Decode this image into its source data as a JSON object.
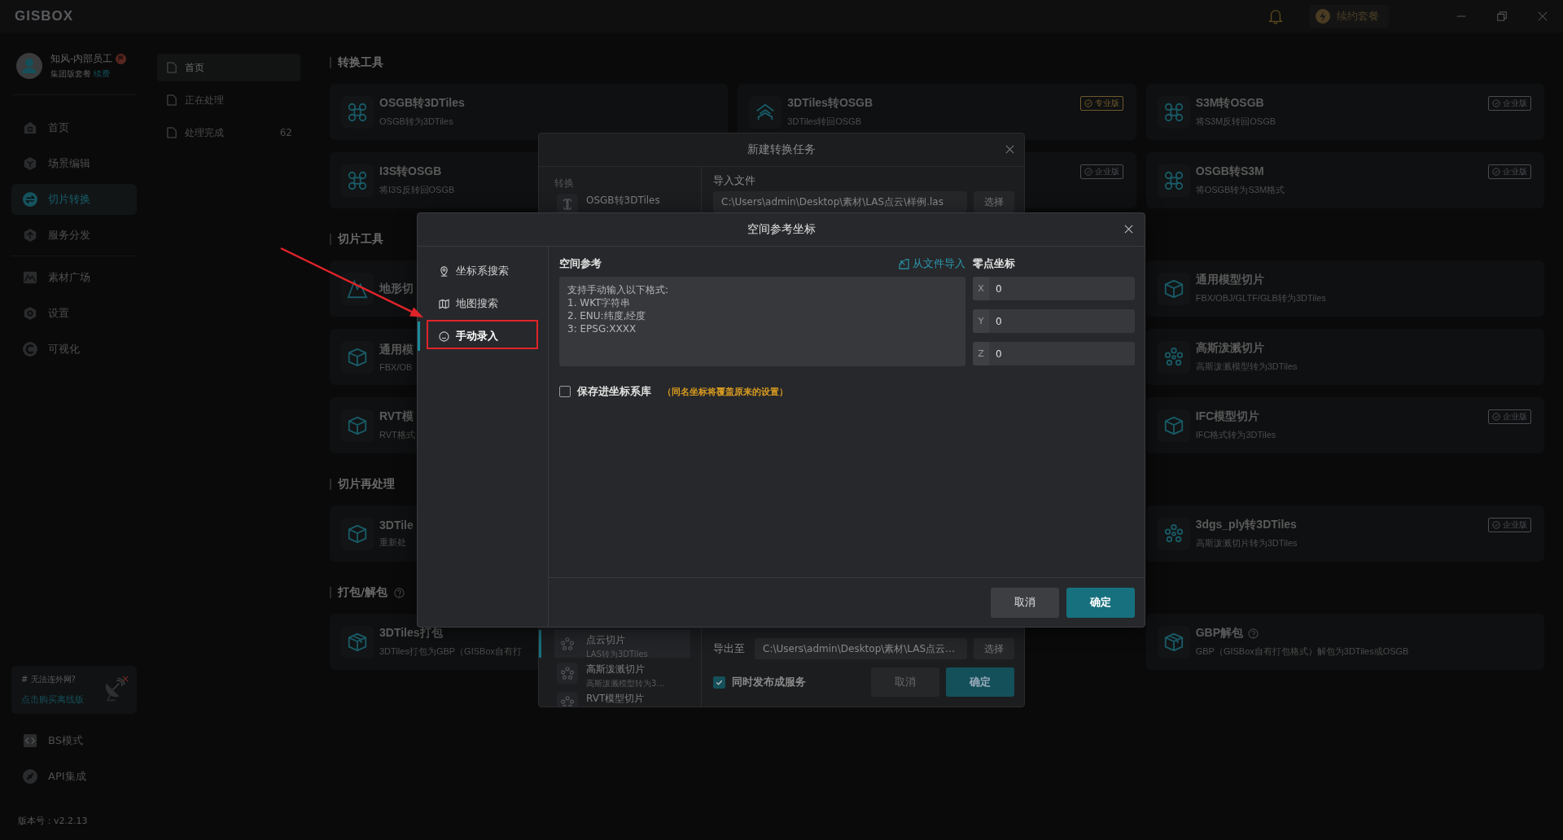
{
  "title_bar": {
    "logo": "GISBOX",
    "renew_button": "续约套餐"
  },
  "user": {
    "name": "知风-内部员工",
    "plan": "集团版套餐",
    "renew_link": "续费"
  },
  "nav_main": [
    {
      "label": "首页",
      "selected": false
    },
    {
      "label": "场景编辑",
      "selected": false
    },
    {
      "label": "切片转换",
      "selected": true
    },
    {
      "label": "服务分发",
      "selected": false
    }
  ],
  "nav_more": [
    {
      "label": "素材广场",
      "selected": false
    },
    {
      "label": "设置",
      "selected": false
    },
    {
      "label": "可视化",
      "selected": false
    }
  ],
  "promo": {
    "title": "# 无法连外网?",
    "link": "点击购买离线版"
  },
  "nav_bottom": [
    {
      "label": "BS模式"
    },
    {
      "label": "API集成"
    }
  ],
  "version": "版本号：v2.2.13",
  "subnav": [
    {
      "label": "首页",
      "selected": true
    },
    {
      "label": "正在处理",
      "selected": false
    },
    {
      "label": "处理完成",
      "count": "62",
      "selected": false
    }
  ],
  "sections": [
    {
      "title": "转换工具",
      "help": false,
      "rows": [
        [
          {
            "title": "OSGB转3DTiles",
            "subtitle": "OSGB转为3DTiles"
          },
          {
            "title": "3DTiles转OSGB",
            "subtitle": "3DTiles转回OSGB",
            "badge": {
              "text": "专业版",
              "color": "#6e5a2c"
            }
          },
          {
            "title": "S3M转OSGB",
            "subtitle": "将S3M反转回OSGB",
            "badge": {
              "text": "企业版",
              "color": "#4a4c50"
            }
          }
        ],
        [
          {
            "title": "I3S转OSGB",
            "subtitle": "将I3S反转回OSGB"
          },
          {
            "badge": {
              "text": "企业版",
              "color": "#4a4c50"
            }
          },
          {
            "title": "OSGB转S3M",
            "subtitle": "将OSGB转为S3M格式",
            "badge": {
              "text": "企业版",
              "color": "#4a4c50"
            }
          }
        ]
      ]
    },
    {
      "title": "切片工具",
      "help": false,
      "rows": [
        [
          {
            "title": "地形切"
          },
          null,
          {
            "title": "通用模型切片",
            "subtitle": "FBX/OBJ/GLTF/GLB转为3DTiles"
          }
        ],
        [
          {
            "title": "通用模",
            "subtitle": "FBX/OB"
          },
          null,
          {
            "title": "高斯泼溅切片",
            "subtitle": "高斯泼溅模型转为3DTiles"
          }
        ],
        [
          {
            "title": "RVT模",
            "subtitle": "RVT格式"
          },
          null,
          {
            "title": "IFC模型切片",
            "subtitle": "IFC格式转为3DTiles",
            "badge": {
              "text": "企业版",
              "color": "#4a4c50"
            }
          }
        ]
      ]
    },
    {
      "title": "切片再处理",
      "help": false,
      "rows": [
        [
          {
            "title": "3DTile",
            "subtitle": "重新处"
          },
          null,
          {
            "title": "3dgs_ply转3DTiles",
            "subtitle": "高斯泼溅切片转为3DTiles",
            "badge": {
              "text": "企业版",
              "color": "#4a4c50"
            }
          }
        ]
      ]
    },
    {
      "title": "打包/解包",
      "help": true,
      "rows": [
        [
          {
            "title": "3DTiles打包",
            "subtitle": "3DTiles打包为GBP（GISBox自有打"
          },
          null,
          {
            "title": "GBP解包",
            "help": true,
            "subtitle": "GBP（GISBox自有打包格式）解包为3DTiles或OSGB"
          }
        ]
      ]
    }
  ],
  "task_dialog": {
    "title": "新建转换任务",
    "list_label": "转换",
    "top_items": [
      {
        "title": "OSGB转3DTiles",
        "selected": false
      }
    ],
    "bottom_items": [
      {
        "title": "点云切片",
        "subtitle": "LAS转为3DTiles",
        "selected": true
      },
      {
        "title": "高斯泼溅切片",
        "subtitle": "高斯泼溅模型转为3…",
        "selected": false
      },
      {
        "title": "RVT模型切片",
        "selected": false
      }
    ],
    "import_label": "导入文件",
    "import_value": "C:\\Users\\admin\\Desktop\\素材\\LAS点云\\样例.las",
    "import_button": "选择",
    "export_label": "导出至",
    "export_value": "C:\\Users\\admin\\Desktop\\素材\\LAS点云…",
    "export_button": "选择",
    "publish": {
      "label": "同时发布成服务",
      "checked": true
    },
    "buttons": [
      "取消",
      "确定"
    ]
  },
  "coord_dialog": {
    "title": "空间参考坐标",
    "tabs": [
      {
        "label": "坐标系搜索",
        "selected": false
      },
      {
        "label": "地图搜索",
        "selected": false
      },
      {
        "label": "手动录入",
        "selected": true
      }
    ],
    "reference_label": "空间参考",
    "import_link": "从文件导入",
    "reference_placeholder": "支持手动输入以下格式:\n1. WKT字符串\n2. ENU:纬度,经度\n3: EPSG:XXXX",
    "origin_label": "零点坐标",
    "origin": [
      {
        "axis": "X",
        "value": "0"
      },
      {
        "axis": "Y",
        "value": "0"
      },
      {
        "axis": "Z",
        "value": "0"
      }
    ],
    "save": {
      "label": "保存进坐标系库",
      "checked": false
    },
    "save_note": "（同名坐标将覆盖原来的设置）",
    "buttons": [
      "取消",
      "确定"
    ]
  }
}
